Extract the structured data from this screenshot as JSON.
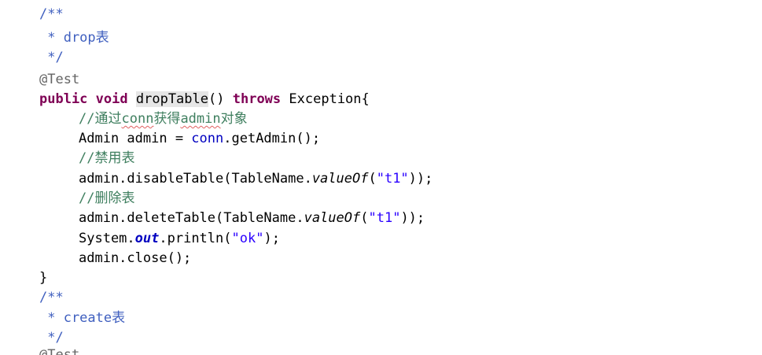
{
  "editor": {
    "lines": [
      {
        "text": "/**"
      },
      {
        "text": " * drop表"
      },
      {
        "text": " */"
      },
      {
        "text": "@Test"
      },
      {
        "parts": [
          "public",
          "void",
          "dropTable",
          "()",
          "throws",
          "Exception{"
        ]
      },
      {
        "parts": [
          "//通过",
          "conn",
          "获得",
          "admin",
          "对象"
        ]
      },
      {
        "parts": [
          "Admin admin = ",
          "conn",
          ".getAdmin();"
        ]
      },
      {
        "text": "//禁用表"
      },
      {
        "parts": [
          "admin.disableTable(TableName.",
          "valueOf",
          "(",
          "\"t1\"",
          "));"
        ]
      },
      {
        "text": "//删除表"
      },
      {
        "parts": [
          "admin.deleteTable(TableName.",
          "valueOf",
          "(",
          "\"t1\"",
          "));"
        ]
      },
      {
        "parts": [
          "System.",
          "out",
          ".println(",
          "\"ok\"",
          ");"
        ]
      },
      {
        "text": "admin.close();"
      },
      {
        "text": "}"
      },
      {
        "text": "/**"
      },
      {
        "text": " * create表"
      },
      {
        "text": " */"
      },
      {
        "text": "@Test"
      }
    ]
  },
  "colors": {
    "javadoc": "#3f5fbf",
    "keyword": "#7f0055",
    "annotation": "#646464",
    "comment": "#3f7f5f",
    "string": "#2a00ff",
    "field": "#0000c0",
    "occurrence_highlight": "#e6e6e6",
    "spelling_underline": "#e06060"
  }
}
